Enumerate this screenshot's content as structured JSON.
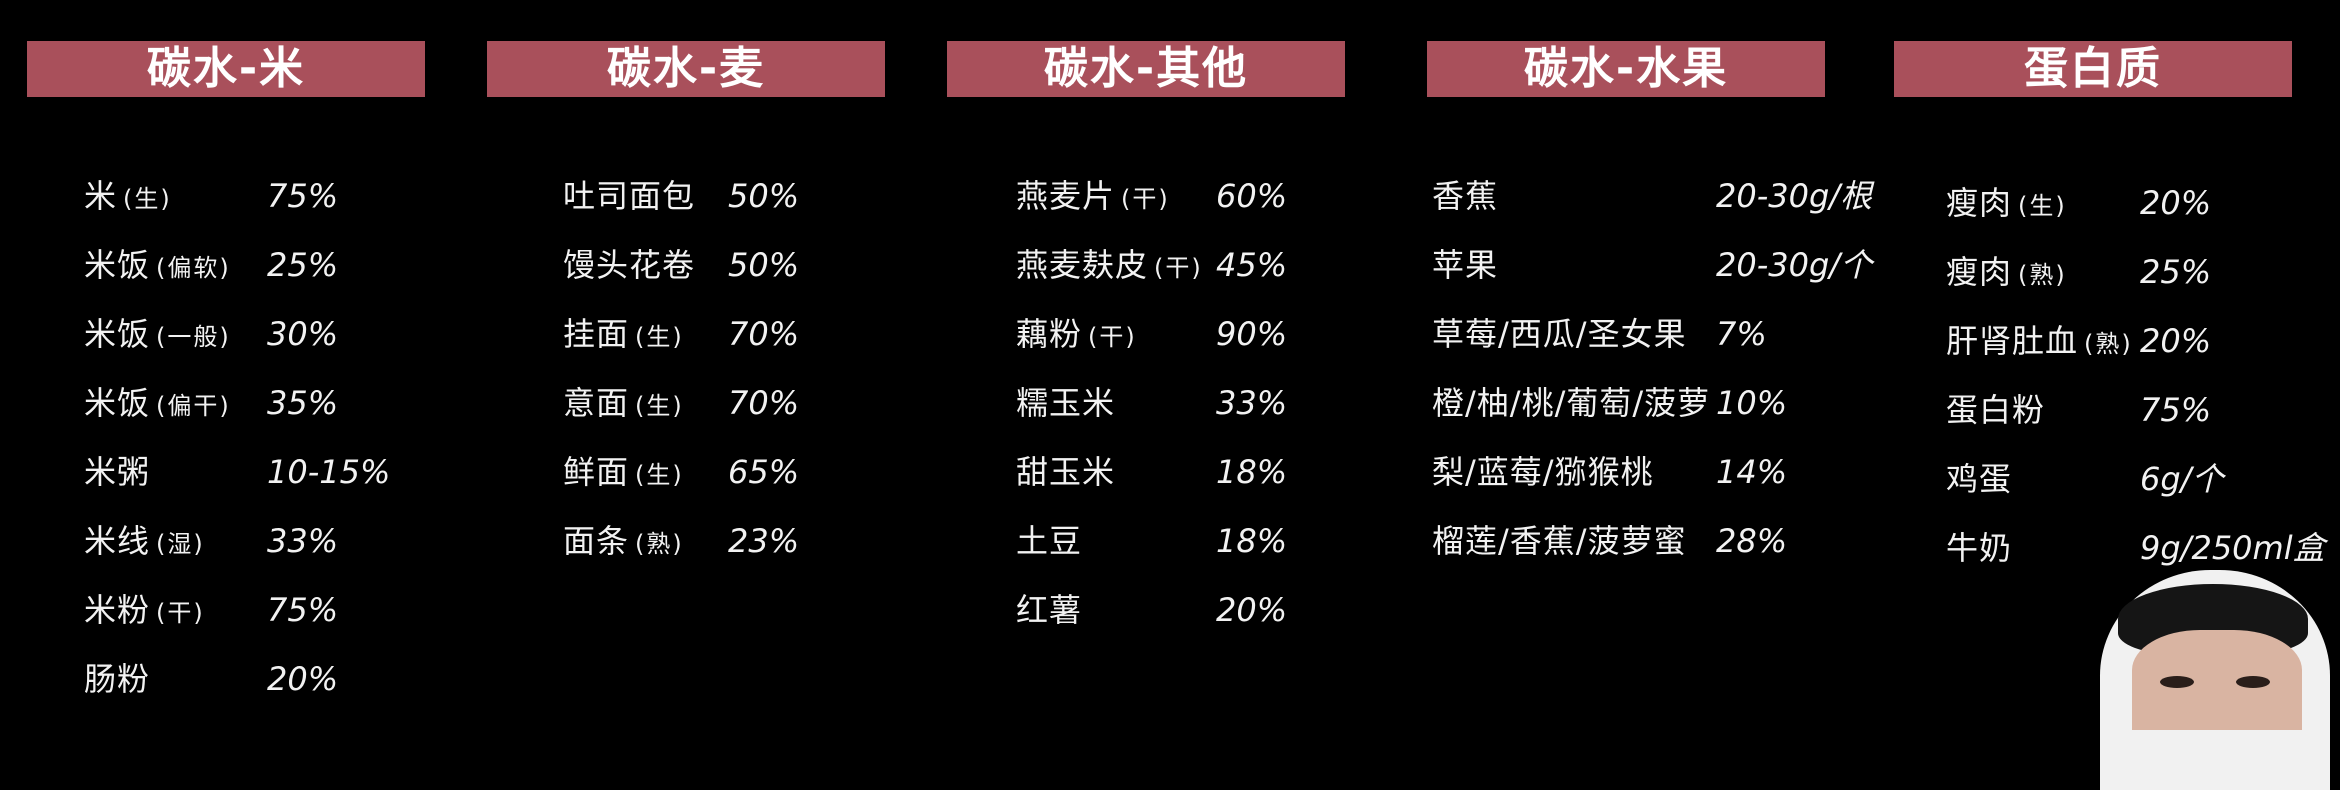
{
  "columns": [
    {
      "header": "碳水-米",
      "items": [
        {
          "name": "米",
          "note": "(生)",
          "value": "75%"
        },
        {
          "name": "米饭",
          "note": "(偏软)",
          "value": "25%"
        },
        {
          "name": "米饭",
          "note": "(一般)",
          "value": "30%"
        },
        {
          "name": "米饭",
          "note": "(偏干)",
          "value": "35%"
        },
        {
          "name": "米粥",
          "note": "",
          "value": "10-15%"
        },
        {
          "name": "米线",
          "note": "(湿)",
          "value": "33%"
        },
        {
          "name": "米粉",
          "note": "(干)",
          "value": "75%"
        },
        {
          "name": "肠粉",
          "note": "",
          "value": "20%"
        }
      ]
    },
    {
      "header": "碳水-麦",
      "items": [
        {
          "name": "吐司面包",
          "note": "",
          "value": "50%"
        },
        {
          "name": "馒头花卷",
          "note": "",
          "value": "50%"
        },
        {
          "name": "挂面",
          "note": "(生)",
          "value": "70%"
        },
        {
          "name": "意面",
          "note": "(生)",
          "value": "70%"
        },
        {
          "name": "鲜面",
          "note": "(生)",
          "value": "65%"
        },
        {
          "name": "面条",
          "note": "(熟)",
          "value": "23%"
        }
      ]
    },
    {
      "header": "碳水-其他",
      "items": [
        {
          "name": "燕麦片",
          "note": "(干)",
          "value": "60%"
        },
        {
          "name": "燕麦麸皮",
          "note": "(干)",
          "value": "45%"
        },
        {
          "name": "藕粉",
          "note": "(干)",
          "value": "90%"
        },
        {
          "name": "糯玉米",
          "note": "",
          "value": "33%"
        },
        {
          "name": "甜玉米",
          "note": "",
          "value": "18%"
        },
        {
          "name": "土豆",
          "note": "",
          "value": "18%"
        },
        {
          "name": "红薯",
          "note": "",
          "value": "20%"
        }
      ]
    },
    {
      "header": "碳水-水果",
      "items": [
        {
          "name": "香蕉",
          "note": "",
          "value": "20-30g/根"
        },
        {
          "name": "苹果",
          "note": "",
          "value": "20-30g/个"
        },
        {
          "name": "草莓/西瓜/圣女果",
          "note": "",
          "value": "7%"
        },
        {
          "name": "橙/柚/桃/葡萄/菠萝",
          "note": "",
          "value": "10%"
        },
        {
          "name": "梨/蓝莓/猕猴桃",
          "note": "",
          "value": "14%"
        },
        {
          "name": "榴莲/香蕉/菠萝蜜",
          "note": "",
          "value": "28%"
        }
      ]
    },
    {
      "header": "蛋白质",
      "items": [
        {
          "name": "瘦肉",
          "note": "(生)",
          "value": "20%"
        },
        {
          "name": "瘦肉",
          "note": "(熟)",
          "value": "25%"
        },
        {
          "name": "肝肾肚血",
          "note": "(熟)",
          "value": "20%"
        },
        {
          "name": "蛋白粉",
          "note": "",
          "value": "75%"
        },
        {
          "name": "鸡蛋",
          "note": "",
          "value": "6g/个"
        },
        {
          "name": "牛奶",
          "note": "",
          "value": "9g/250ml盒"
        }
      ]
    }
  ]
}
